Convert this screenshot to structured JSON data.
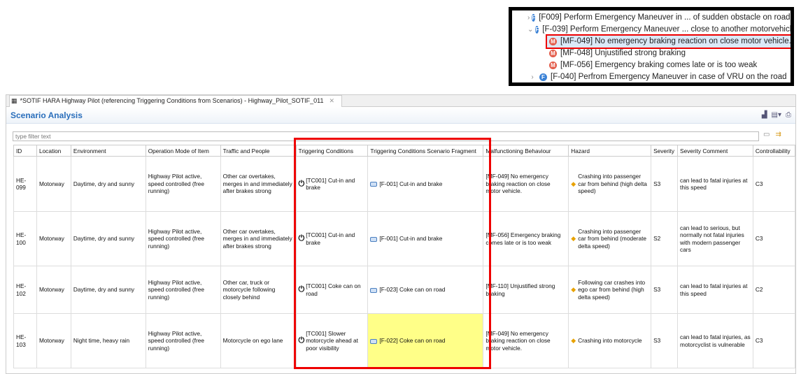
{
  "tree": [
    {
      "expander": ">",
      "icon": "F",
      "label": "[F009] Perform Emergency Maneuver in ... of sudden obstacle on road [1"
    },
    {
      "expander": "v",
      "icon": "F",
      "label": "[F-039] Perform Emergency Maneuver ... close to another motorvehicle"
    },
    {
      "icon": "M",
      "label": "[MF-049] No emergency braking reaction on close motor vehicle.",
      "selected": true
    },
    {
      "icon": "M",
      "label": "[MF-048] Unjustified strong braking"
    },
    {
      "icon": "M",
      "label": "[MF-056] Emergency braking comes late or is too weak"
    },
    {
      "expander": ">",
      "icon": "F",
      "label": "[F-040] Perfrom Emergency Maneuver in case of VRU on the road"
    }
  ],
  "editor": {
    "tab_title": "*SOTIF HARA Highway Pilot (referencing Triggering Conditions from Scenarios) - Highway_Pilot_SOTIF_011",
    "section_title": "Scenario Analysis",
    "filter_placeholder": "type filter text"
  },
  "columns": [
    "ID",
    "Location",
    "Environment",
    "Operation Mode of Item",
    "Traffic and People",
    "Triggering Conditions",
    "Triggering Conditions Scenario Fragment",
    "Malfunctioning Behaviour",
    "Hazard",
    "Severity",
    "Severity Comment",
    "Controllability"
  ],
  "rows": [
    {
      "id": "HE-099",
      "location": "Motorway",
      "environment": "Daytime, dry and sunny",
      "op_mode": "Highway Pilot active, speed controlled (free running)",
      "traffic": "Other car overtakes, merges in and immediately after brakes strong",
      "tc": "[TC001] Cut-in and brake",
      "fragment": "[F-001] Cut-in and brake",
      "mb": "[MF-049] No emergency braking reaction on close motor vehicle.",
      "hazard": "Crashing into passenger car from behind (high delta speed)",
      "severity": "S3",
      "sev_comment": "can lead to fatal injuries at this speed",
      "controllability": "C3"
    },
    {
      "id": "HE-100",
      "location": "Motorway",
      "environment": "Daytime, dry and sunny",
      "op_mode": "Highway Pilot active, speed controlled (free running)",
      "traffic": "Other car overtakes, merges in and immediately after brakes strong",
      "tc": "[TC001] Cut-in and brake",
      "fragment": "[F-001] Cut-in and brake",
      "mb": "[MF-056] Emergency braking comes late or is too weak",
      "hazard": "Crashing into passenger car from behind (moderate delta speed)",
      "severity": "S2",
      "sev_comment": "can lead to serious, but normally not fatal injuries with modern passenger cars",
      "controllability": "C3"
    },
    {
      "id": "HE-102",
      "location": "Motorway",
      "environment": "Daytime, dry and sunny",
      "op_mode": "Highway Pilot active, speed controlled (free running)",
      "traffic": "Other car, truck or motorcycle following closely behind",
      "tc": "[TC001] Coke can on road",
      "fragment": "[F-023] Coke can on road",
      "mb": "[MF-110] Unjustified strong braking",
      "hazard": "Following car crashes into ego car from behind (high delta speed)",
      "severity": "S3",
      "sev_comment": "can lead to fatal injuries at this speed",
      "controllability": "C2"
    },
    {
      "id": "HE-103",
      "location": "Motorway",
      "environment": "Night time, heavy rain",
      "op_mode": "Highway Pilot active, speed controlled (free running)",
      "traffic": "Motorcycle on ego lane",
      "tc": "[TC001] Slower motorcycle ahead at poor visibility",
      "fragment": "[F-022] Coke can on road",
      "mb": "[MF-049] No emergency braking reaction on close motor vehicle.",
      "hazard": "Crashing into motorcycle",
      "severity": "S3",
      "sev_comment": "can lead to fatal injuries, as motorcyclist is vulnerable",
      "controllability": "C3",
      "highlight_fragment": true
    }
  ],
  "colors": {
    "highlight": "#ffff88",
    "annotation": "#e00000",
    "title": "#2a6ebb"
  }
}
